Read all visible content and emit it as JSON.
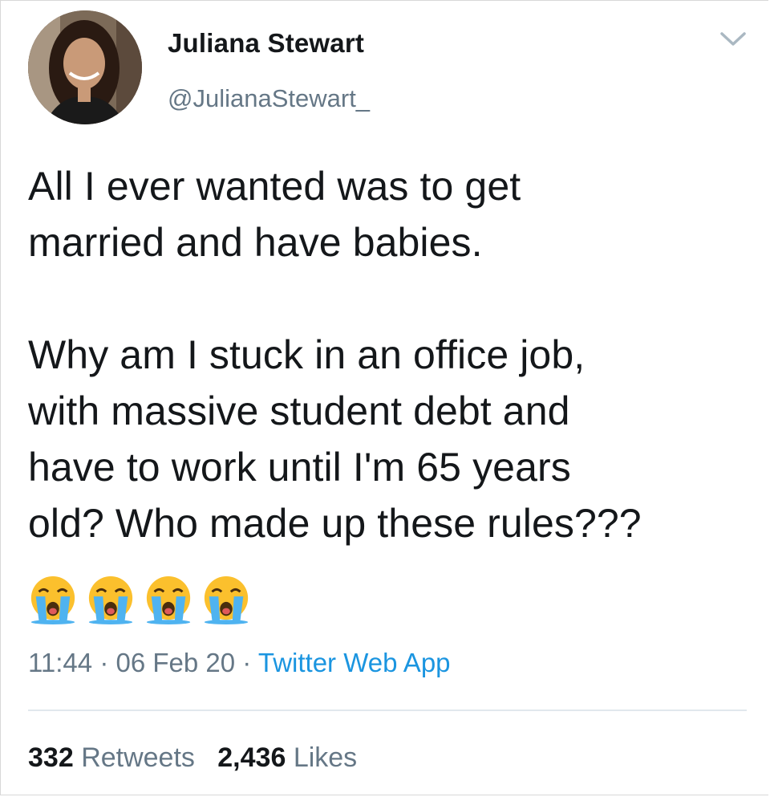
{
  "author": {
    "name": "Juliana Stewart",
    "handle": "@JulianaStewart_"
  },
  "tweet": {
    "text": "All I ever wanted was to get\nmarried and have babies.\n\nWhy am I stuck in an office job,\nwith massive student debt and\nhave to work until I'm 65 years\nold? Who made up these rules???",
    "emojis": [
      "loudly-crying-face",
      "loudly-crying-face",
      "loudly-crying-face",
      "loudly-crying-face"
    ]
  },
  "meta": {
    "time": "11:44",
    "date": "06 Feb 20",
    "separator": "·",
    "source": "Twitter Web App"
  },
  "stats": {
    "retweets_count": "332",
    "retweets_label": "Retweets",
    "likes_count": "2,436",
    "likes_label": "Likes"
  },
  "colors": {
    "text": "#14171a",
    "secondary": "#657786",
    "link": "#1b95e0",
    "divider": "#e1e8ed"
  },
  "icons": {
    "menu": "chevron-down-icon",
    "emoji": "loudly-crying-face-emoji"
  }
}
